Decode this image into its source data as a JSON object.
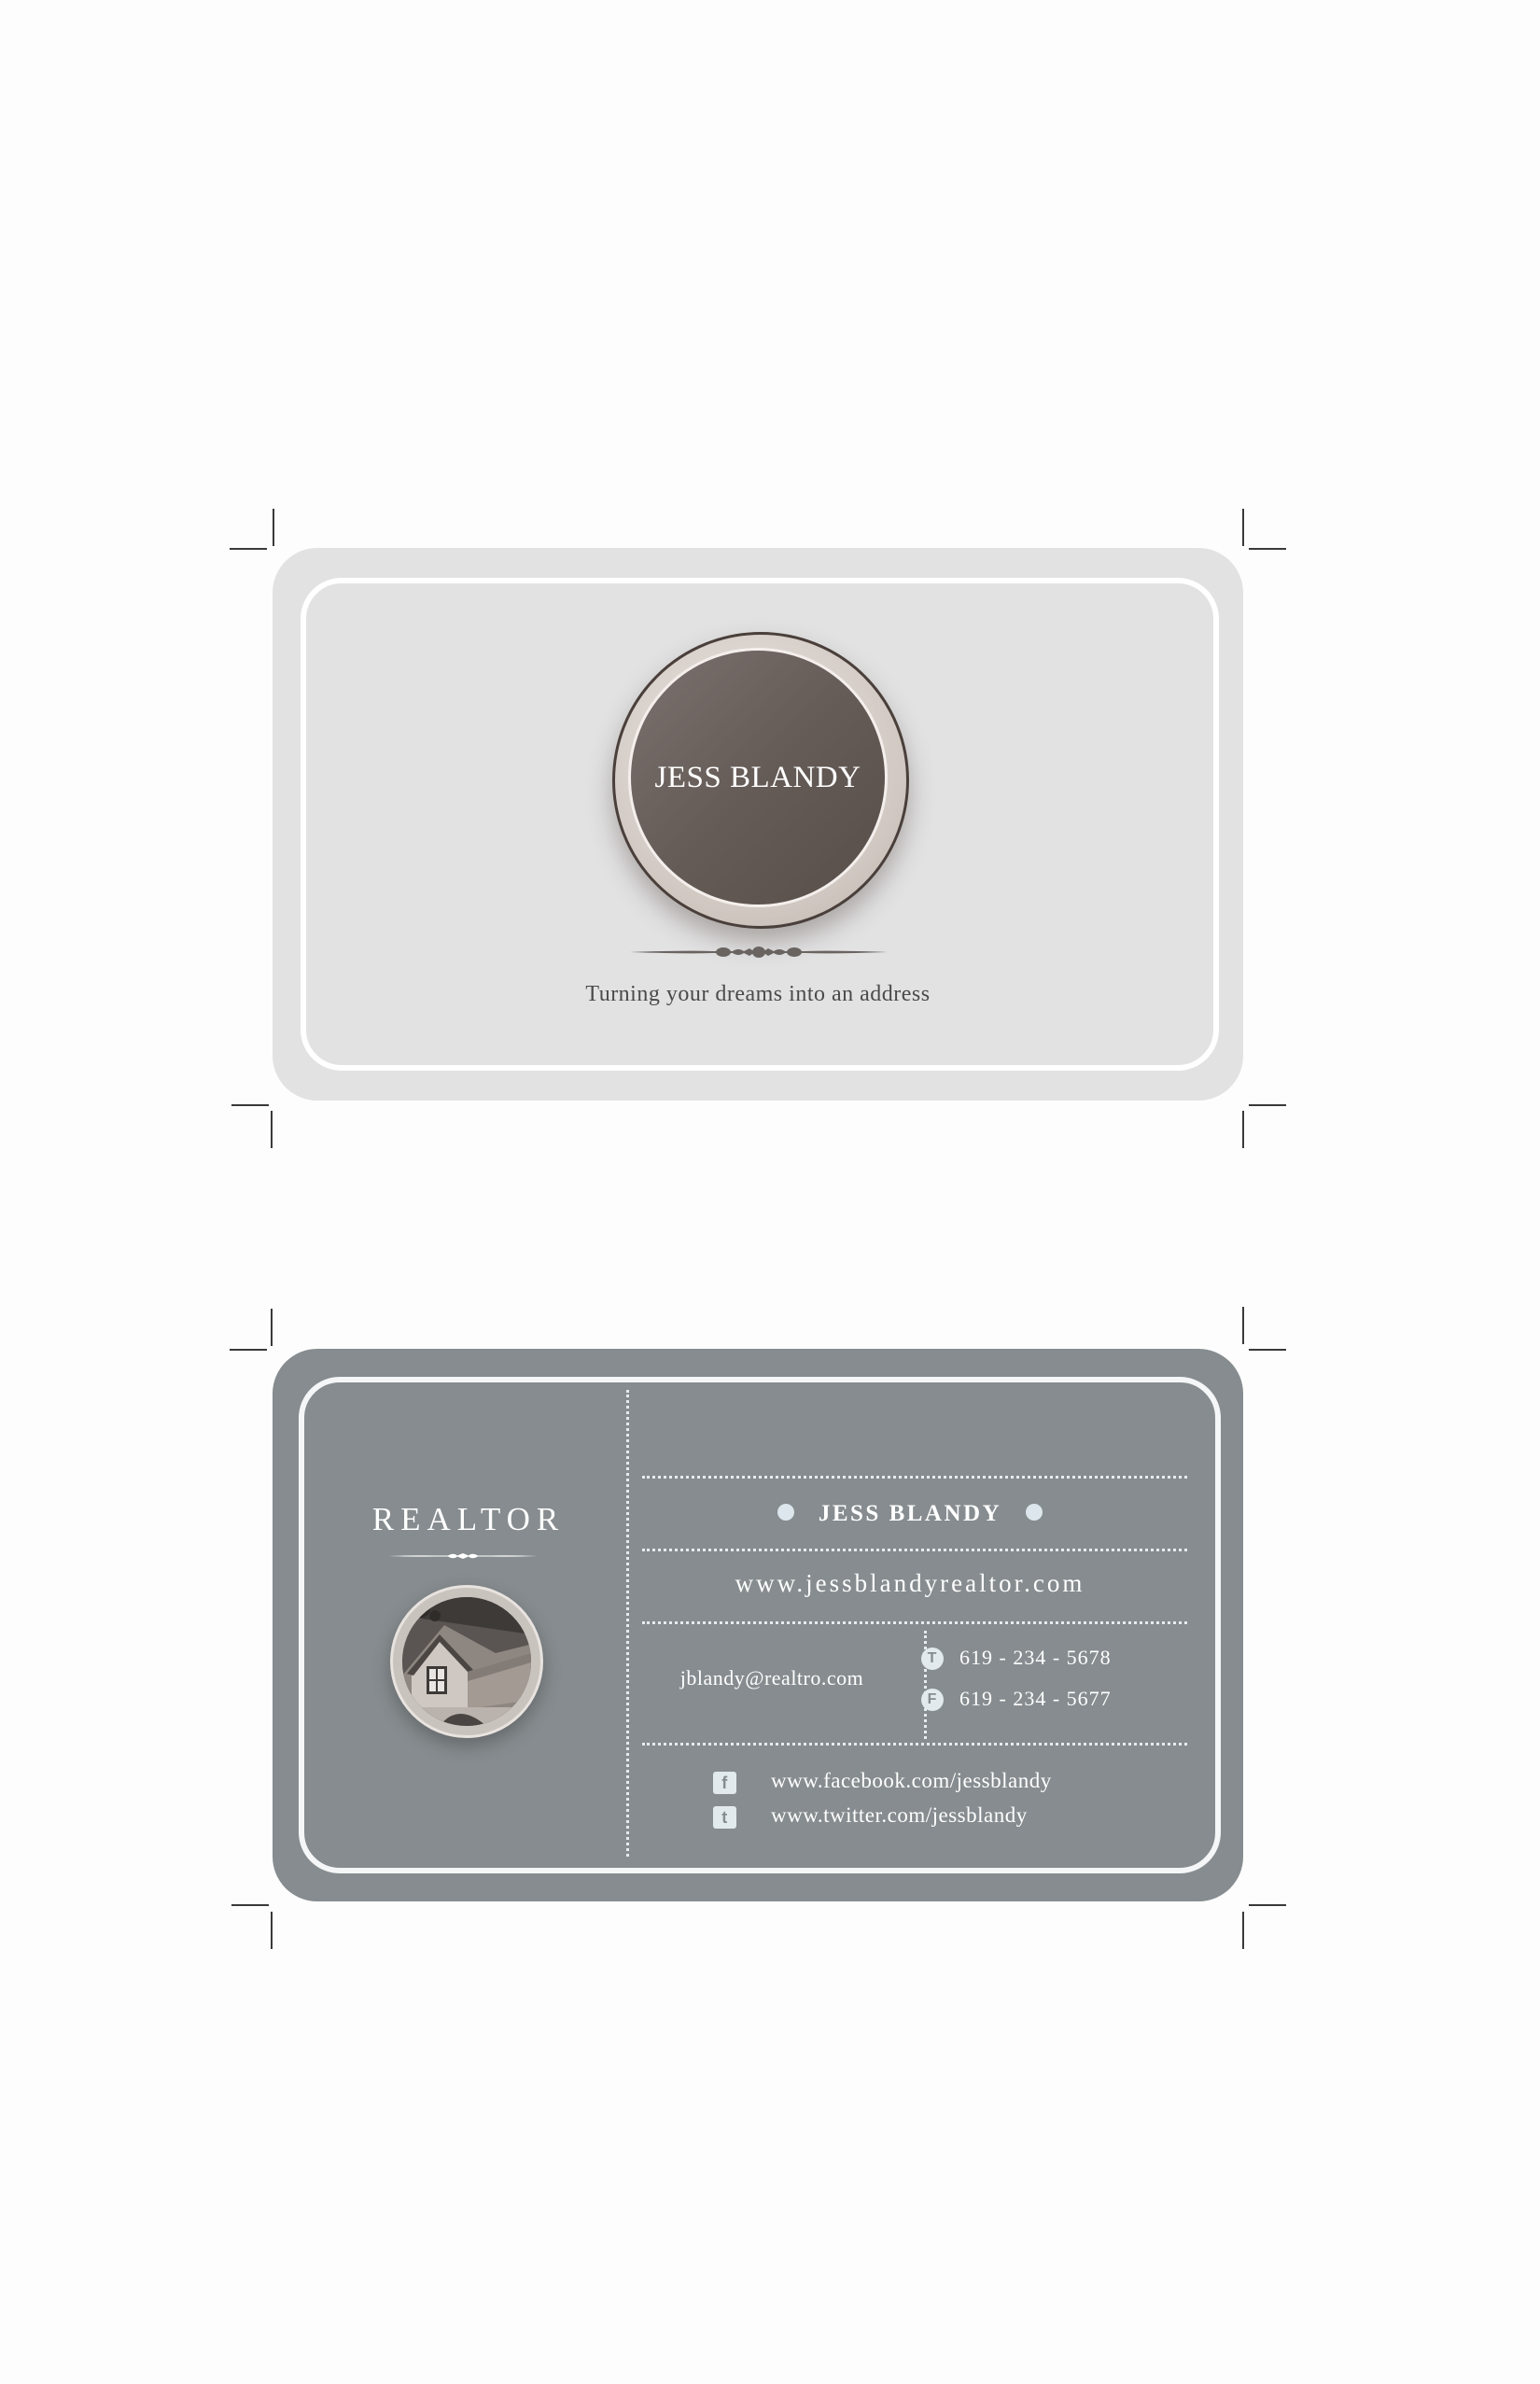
{
  "front": {
    "name": "JESS BLANDY",
    "tagline": "Turning your dreams into an address",
    "colors": {
      "card": "#e2e2e3",
      "badge": "#655b57",
      "border": "#ffffff"
    }
  },
  "back": {
    "title": "REALTOR",
    "name": "JESS BLANDY",
    "website": "www.jessblandyrealtor.com",
    "email": "jblandy@realtro.com",
    "phones": [
      {
        "icon_letter": "T",
        "icon_name": "telephone-icon",
        "number": "619 - 234 - 5678"
      },
      {
        "icon_letter": "F",
        "icon_name": "fax-icon",
        "number": "619 - 234 - 5677"
      }
    ],
    "social": [
      {
        "icon_letter": "f",
        "icon_name": "facebook-icon",
        "url": "www.facebook.com/jessblandy"
      },
      {
        "icon_letter": "t",
        "icon_name": "twitter-icon",
        "url": "www.twitter.com/jessblandy"
      }
    ],
    "colors": {
      "card": "#868c8f",
      "border": "#f4f6f7",
      "accent": "#dce6ec"
    }
  }
}
